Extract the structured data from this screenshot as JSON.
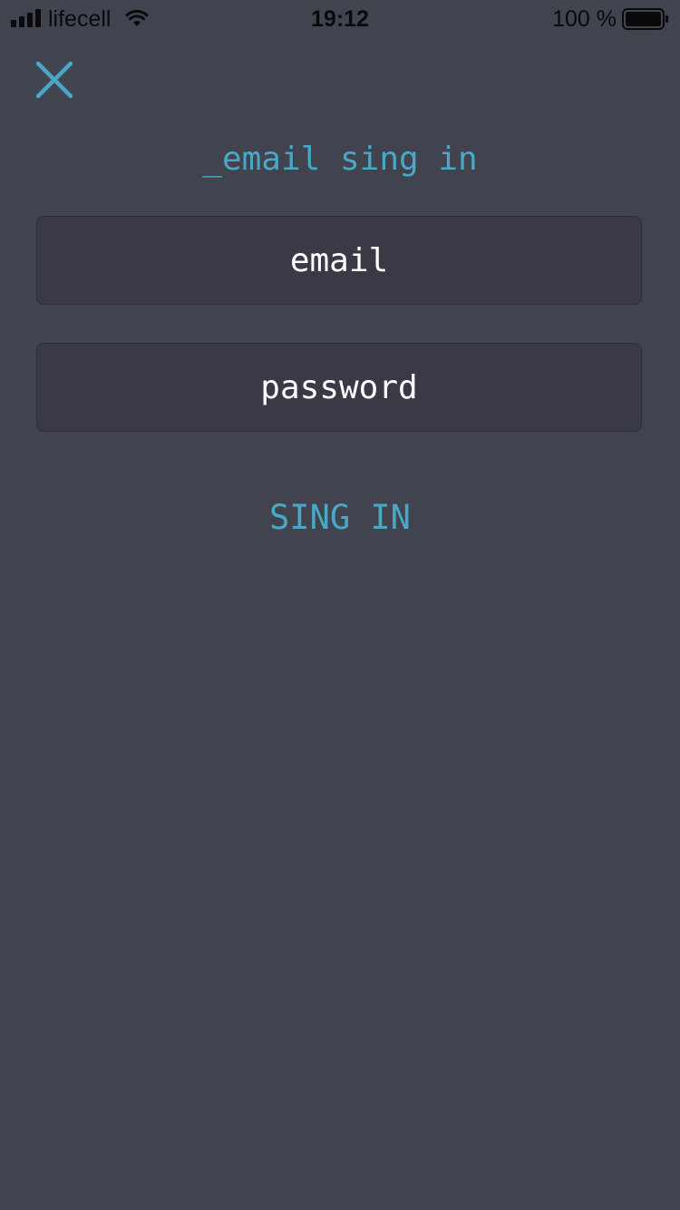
{
  "status_bar": {
    "carrier": "lifecell",
    "time": "19:12",
    "battery_percent": "100 %",
    "battery_level": 1.0
  },
  "header": {
    "close_icon": "close-icon",
    "title": "_email sing in"
  },
  "form": {
    "email_placeholder": "email",
    "email_value": "",
    "password_placeholder": "password",
    "password_value": "",
    "submit_label": "SING IN"
  },
  "colors": {
    "background": "#41444f",
    "accent": "#4aa8c6",
    "field_background": "#393a46",
    "text": "#ffffff"
  }
}
